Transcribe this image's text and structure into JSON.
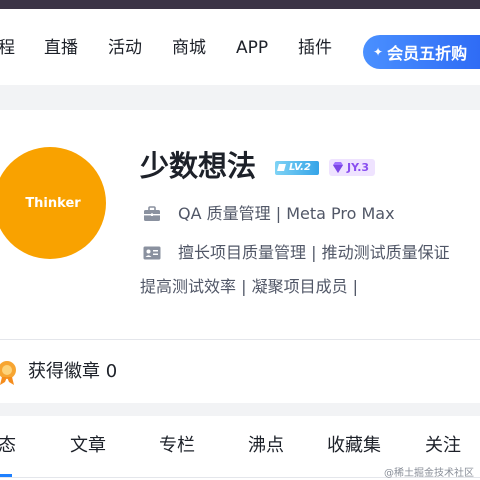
{
  "nav": {
    "items": [
      "程",
      "直播",
      "活动",
      "商城",
      "APP",
      "插件"
    ],
    "vip_label": "会员五折购"
  },
  "profile": {
    "avatar_text": "Thinker",
    "name": "少数想法",
    "level_badge": "LV.2",
    "jy_badge": "JY.3",
    "job": "QA 质量管理 | Meta Pro Max",
    "intro_line1": "擅长项目质量管理 | 推动测试质量保证",
    "intro_line2": "提高测试效率 | 凝聚项目成员 |"
  },
  "badges": {
    "label": "获得徽章 0"
  },
  "tabs": {
    "items": [
      "态",
      "文章",
      "专栏",
      "沸点",
      "收藏集",
      "关注"
    ],
    "active_index": 0
  },
  "watermark": "@稀土掘金技术社区",
  "colors": {
    "accent": "#1e80ff",
    "avatar_bg": "#f9a200",
    "vip_gradient_start": "#4a90ff",
    "vip_gradient_end": "#2f6cf5"
  }
}
